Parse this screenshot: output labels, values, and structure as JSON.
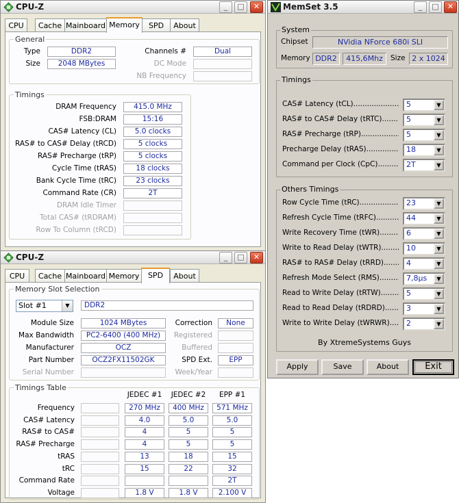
{
  "cpuz_top": {
    "title": "CPU-Z",
    "tabs": [
      "CPU",
      "Cache",
      "Mainboard",
      "Memory",
      "SPD",
      "About"
    ],
    "general": {
      "title": "General",
      "type_label": "Type",
      "type_value": "DDR2",
      "size_label": "Size",
      "size_value": "2048 MBytes",
      "channels_label": "Channels #",
      "channels_value": "Dual",
      "dc_label": "DC Mode",
      "nb_label": "NB Frequency"
    },
    "timings": {
      "title": "Timings",
      "rows": [
        {
          "label": "DRAM Frequency",
          "value": "415.0 MHz"
        },
        {
          "label": "FSB:DRAM",
          "value": "15:16"
        },
        {
          "label": "CAS# Latency (CL)",
          "value": "5.0 clocks"
        },
        {
          "label": "RAS# to CAS# Delay (tRCD)",
          "value": "5 clocks"
        },
        {
          "label": "RAS# Precharge (tRP)",
          "value": "5 clocks"
        },
        {
          "label": "Cycle Time (tRAS)",
          "value": "18 clocks"
        },
        {
          "label": "Bank Cycle Time (tRC)",
          "value": "23 clocks"
        },
        {
          "label": "Command Rate (CR)",
          "value": "2T"
        },
        {
          "label": "DRAM Idle Timer",
          "value": ""
        },
        {
          "label": "Total CAS# (tRDRAM)",
          "value": ""
        },
        {
          "label": "Row To Column (tRCD)",
          "value": ""
        }
      ]
    }
  },
  "cpuz_bottom": {
    "title": "CPU-Z",
    "tabs": [
      "CPU",
      "Cache",
      "Mainboard",
      "Memory",
      "SPD",
      "About"
    ],
    "slot": {
      "title": "Memory Slot Selection",
      "selected": "Slot #1",
      "type_value": "DDR2",
      "rows_left": [
        {
          "label": "Module Size",
          "value": "1024 MBytes"
        },
        {
          "label": "Max Bandwidth",
          "value": "PC2-6400 (400 MHz)"
        },
        {
          "label": "Manufacturer",
          "value": "OCZ"
        },
        {
          "label": "Part Number",
          "value": "OCZ2FX11502GK"
        },
        {
          "label": "Serial Number",
          "value": ""
        }
      ],
      "rows_right": [
        {
          "label": "Correction",
          "value": "None"
        },
        {
          "label": "Registered",
          "value": ""
        },
        {
          "label": "Buffered",
          "value": ""
        },
        {
          "label": "SPD Ext.",
          "value": "EPP"
        },
        {
          "label": "Week/Year",
          "value": ""
        }
      ]
    },
    "table": {
      "title": "Timings Table",
      "headers": [
        "JEDEC #1",
        "JEDEC #2",
        "EPP #1"
      ],
      "rows": [
        {
          "label": "Frequency",
          "values": [
            "270 MHz",
            "400 MHz",
            "571 MHz"
          ]
        },
        {
          "label": "CAS# Latency",
          "values": [
            "4.0",
            "5.0",
            "5.0"
          ]
        },
        {
          "label": "RAS# to CAS#",
          "values": [
            "4",
            "5",
            "5"
          ]
        },
        {
          "label": "RAS# Precharge",
          "values": [
            "4",
            "5",
            "5"
          ]
        },
        {
          "label": "tRAS",
          "values": [
            "13",
            "18",
            "15"
          ]
        },
        {
          "label": "tRC",
          "values": [
            "15",
            "22",
            "32"
          ]
        },
        {
          "label": "Command Rate",
          "values": [
            "",
            "",
            "2T"
          ]
        },
        {
          "label": "Voltage",
          "values": [
            "1.8 V",
            "1.8 V",
            "2.100 V"
          ]
        }
      ]
    }
  },
  "memset": {
    "title": "MemSet 3.5",
    "system": {
      "title": "System",
      "chipset_label": "Chipset",
      "chipset_value": "NVidia NForce 680i SLI",
      "memory_label": "Memory",
      "mem_type": "DDR2",
      "mem_freq": "415,6Mhz",
      "size_label": "Size",
      "size_value": "2 x 1024"
    },
    "timings": {
      "title": "Timings",
      "rows": [
        {
          "label": "CAS# Latency (tCL)",
          "value": "5"
        },
        {
          "label": "RAS# to CAS# Delay (tRTC)",
          "value": "5"
        },
        {
          "label": "RAS# Precharge (tRP)",
          "value": "5"
        },
        {
          "label": "Precharge Delay  (tRAS)",
          "value": "18"
        },
        {
          "label": "Command per Clock (CpC)",
          "value": "2T"
        }
      ]
    },
    "others": {
      "title": "Others Timings",
      "rows": [
        {
          "label": "Row Cycle Time (tRC)",
          "value": "23"
        },
        {
          "label": "Refresh Cycle Time (tRFC)",
          "value": "44"
        },
        {
          "label": "Write Recovery Time (tWR)",
          "value": "6"
        },
        {
          "label": "Write to Read Delay (tWTR)",
          "value": "10"
        },
        {
          "label": "RAS# to RAS# Delay (tRRD)",
          "value": "4"
        },
        {
          "label": "Refresh Mode Select (RMS)",
          "value": "7,8µs"
        },
        {
          "label": "Read to Write Delay (tRTW)",
          "value": "5"
        },
        {
          "label": "Read to Read Delay (tRDRD)",
          "value": "3"
        },
        {
          "label": "Write to Write Delay (tWRWR)",
          "value": "2"
        }
      ]
    },
    "credit": "By XtremeSystems Guys",
    "buttons": {
      "apply": "Apply",
      "save": "Save",
      "about": "About",
      "exit": "Exit"
    }
  },
  "caption_buttons": {
    "minimize": "_",
    "maximize": "□",
    "close": "✕"
  },
  "dropdown_arrow": "▼",
  "colors": {
    "value_text": "#1c2aa0",
    "active_tab_accent": "#e79b2c",
    "close_button": "#c5371c"
  }
}
